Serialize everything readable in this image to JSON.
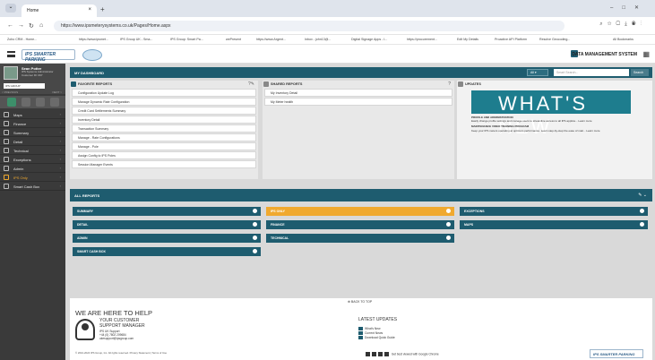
{
  "browser": {
    "tab_title": "Home",
    "url": "https://www.ipsmeterysystems.co.uk/Pages/Home.aspx",
    "bookmarks": [
      "Zoho CRM - Home...",
      "https://www.ipsmet...",
      "IPS Group UK - Sma...",
      "IPS Group: Smart Pa...",
      "wePresent",
      "https://www.Argent...",
      "Inbox - john13@...",
      "Digital Signage Apps - I...",
      "https://procurement...",
      "Edit My Details",
      "Proactive API Platform",
      "Resolve Geocoding...",
      "All Bookmarks"
    ]
  },
  "header": {
    "logo_text": "IPS SMARTER PARKING",
    "system_title": "DATA MANAGEMENT SYSTEM"
  },
  "sidebar": {
    "user_name": "Sean Potter",
    "user_role": "IPS Systems Administrator",
    "user_customer": "Customer ID: 097",
    "customer_select": "IPS GROUP",
    "row_left": "< PREVIOUS",
    "row_right": "NEXT >",
    "items": [
      {
        "label": "Maps",
        "icon": "map-icon"
      },
      {
        "label": "Finance",
        "icon": "finance-icon"
      },
      {
        "label": "Summary",
        "icon": "summary-icon"
      },
      {
        "label": "Detail",
        "icon": "detail-icon"
      },
      {
        "label": "Technical",
        "icon": "wrench-icon"
      },
      {
        "label": "Exceptions",
        "icon": "warning-icon"
      },
      {
        "label": "Admin",
        "icon": "admin-icon"
      },
      {
        "label": "IPS Only",
        "icon": "star-icon"
      },
      {
        "label": "Smart Cash Box",
        "icon": "cashbox-icon"
      }
    ]
  },
  "dashboard": {
    "title": "MY DASHBOARD",
    "dropdown": "All",
    "search_placeholder": "Smart Search...",
    "search_button": "Search"
  },
  "favorite_reports": {
    "title": "FAVORITE REPORTS",
    "items": [
      "Configuration Update Log",
      "Manage Dynamic Rate Configuration",
      "Credit Card Settlements Summary",
      "Inventory Detail",
      "Transaction Summary",
      "Manage - Rate Configurations",
      "Manage - Pole",
      "Assign Config to IPS Poles",
      "Session Manager Events"
    ]
  },
  "shared_reports": {
    "title": "SHARED REPORTS",
    "items": [
      "My Inventory Detail",
      "My Meter health"
    ]
  },
  "updates": {
    "title": "UPDATES",
    "banner": "WHAT'S NEW",
    "item1_title": "PROFILE AND ADMINISTRATION",
    "item1_text": "Easily change profile settings and manage users to streamline access to all IPS applica... Learn more",
    "item2_title": "MAINTENANCE VIDEO TRAINING PROGRAM",
    "item2_text": "Keep your IPS meters operating at optimum performance. Learn step-by-step the ease of mait... Learn more"
  },
  "all_reports": {
    "title": "ALL REPORTS",
    "tiles": [
      "SUMMARY",
      "IPS ONLY",
      "EXCEPTIONS",
      "DETAIL",
      "FINANCE",
      "MAPS",
      "ADMIN",
      "TECHNICAL",
      "SMART CASH BOX"
    ]
  },
  "footer": {
    "back_to_top": "BACK TO TOP",
    "help_title": "WE ARE HERE TO HELP",
    "csm_title_1": "YOUR CUSTOMER",
    "csm_title_2": "SUPPORT MANAGER",
    "csm_line1": "IPS UK Support",
    "csm_line2": "+44 (0) 7802 209684",
    "csm_line3": "ukesupport@ipsgroup.com",
    "copyright": "© 2010-2024 IPS Group, Inc. All rights reserved.   Privacy Statement  |  Terms of Use",
    "latest_title": "LATEST UPDATES",
    "latest_items": [
      "What's New",
      "Current News",
      "Download Quick Guide"
    ],
    "social_text": "Get best viewed with Google Chrome"
  }
}
